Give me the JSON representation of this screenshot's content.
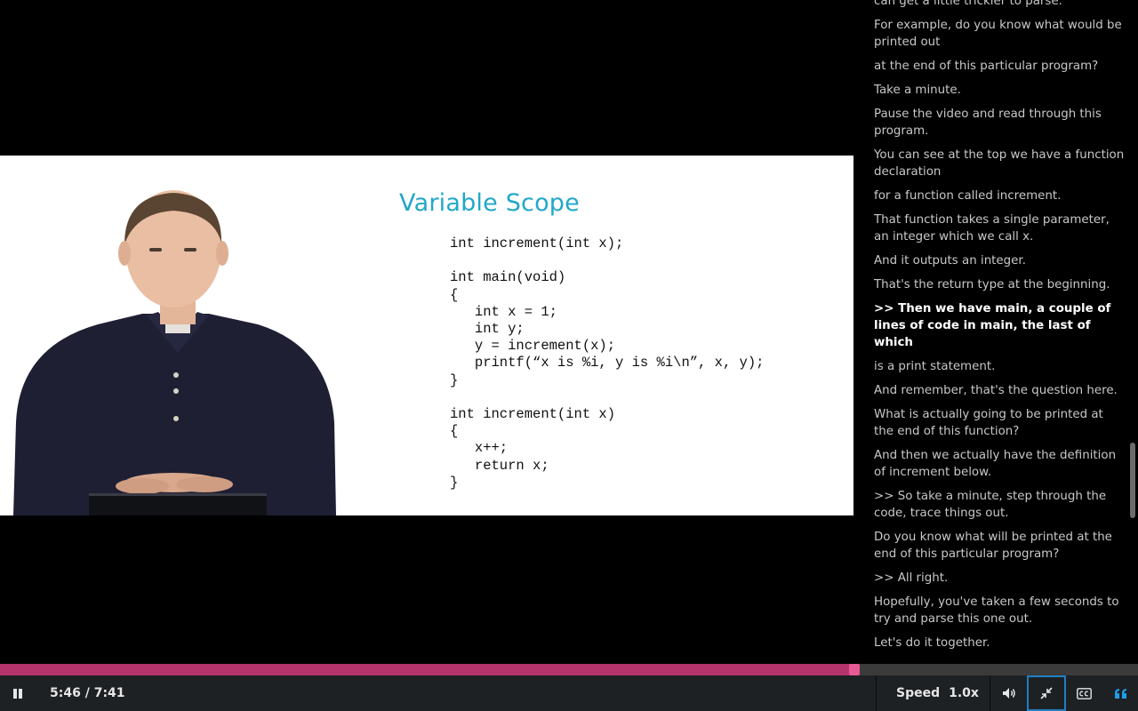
{
  "player": {
    "current_time": "5:46",
    "separator": " / ",
    "duration": "7:41",
    "progress_fraction": 0.75,
    "speed_label": "Speed",
    "speed_value": "1.0x",
    "colors": {
      "progress": "#b5346b",
      "handle": "#e85a93",
      "accent": "#1f7ec2",
      "transcript_icon": "#1f9ee8"
    }
  },
  "slide": {
    "title": "Variable Scope",
    "code": "int increment(int x);\n\nint main(void)\n{\n   int x = 1;\n   int y;\n   y = increment(x);\n   printf(“x is %i, y is %i\\n”, x, y);\n}\n\nint increment(int x)\n{\n   x++;\n   return x;\n}"
  },
  "transcript": {
    "lines": [
      "can get a little trickier to parse.",
      "For example, do you know what would be printed out",
      "at the end of this particular program?",
      "Take a minute.",
      "Pause the video and read through this program.",
      "You can see at the top we have a function declaration",
      "for a function called increment.",
      "That function takes a single parameter, an integer which we call x.",
      "And it outputs an integer.",
      "That's the return type at the beginning.",
      ">> Then we have main, a couple of lines of code in main, the last of which",
      "is a print statement.",
      "And remember, that's the question here.",
      "What is actually going to be printed at the end of this function?",
      "And then we actually have the definition of increment below.",
      ">> So take a minute, step through the code, trace things out.",
      "Do you know what will be printed at the end of this particular program?",
      ">> All right.",
      "Hopefully, you've taken a few seconds to try and parse this one out.",
      "Let's do it together."
    ],
    "current_index": 10
  }
}
